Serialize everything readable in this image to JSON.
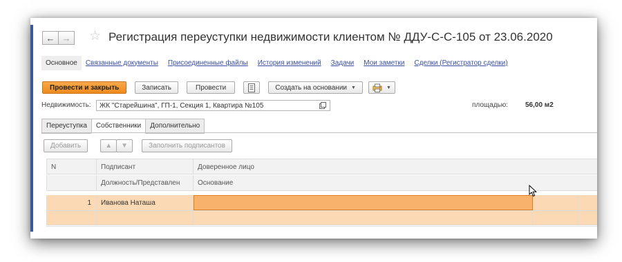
{
  "window": {
    "title": "Регистрация переуступки недвижимости клиентом № ДДУ-С-С-105 от 23.06.2020",
    "back_icon": "←",
    "forward_icon": "→",
    "star_icon": "☆"
  },
  "links": {
    "active": "Основное",
    "items": [
      "Связанные документы",
      "Присоединенные файлы",
      "История изменений",
      "Задачи",
      "Мои заметки",
      "Сделки (Регистратор сделки)"
    ]
  },
  "toolbar": {
    "post_close": "Провести и закрыть",
    "save": "Записать",
    "post": "Провести",
    "create_based": "Создать на основании"
  },
  "property": {
    "label": "Недвижимость:",
    "value": "ЖК \"Старейшина\", ГП-1, Секция 1, Квартира №105",
    "area_label": "площадью:",
    "area_value": "56,00  м2"
  },
  "tabs": [
    "Переуступка",
    "Собственники",
    "Дополнительно"
  ],
  "table_toolbar": {
    "add": "Добавить",
    "fill": "Заполнить подписантов"
  },
  "table": {
    "header_row1": [
      "N",
      "Подписант",
      "Доверенное лицо"
    ],
    "header_row2": [
      "",
      "Должность/Представлен",
      "Основание"
    ],
    "rows": [
      {
        "n": "1",
        "signer": "Иванова Наташа",
        "proxy": ""
      }
    ]
  },
  "colors": {
    "accent": "#ee8a1d",
    "selection": "#fbd9b5",
    "link": "#3a4fa3"
  }
}
